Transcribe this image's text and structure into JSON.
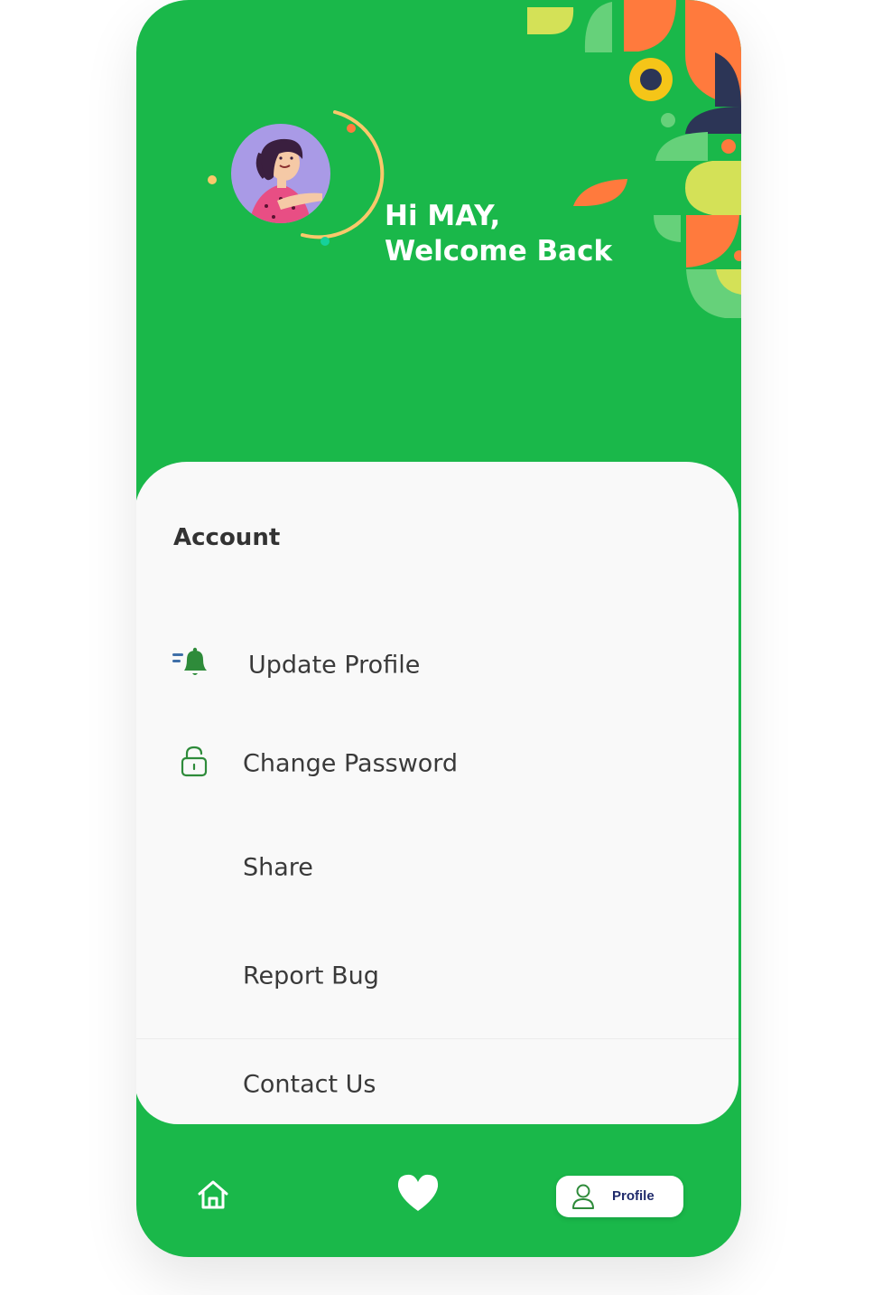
{
  "header": {
    "greeting_line1": "Hi MAY,",
    "greeting_line2": "Welcome Back"
  },
  "account": {
    "title": "Account",
    "items": [
      {
        "label": "Update Profile",
        "icon": "bell-icon"
      },
      {
        "label": "Change Password",
        "icon": "lock-icon"
      },
      {
        "label": "Share",
        "icon": ""
      },
      {
        "label": "Report Bug",
        "icon": ""
      },
      {
        "label": "Contact Us",
        "icon": ""
      }
    ]
  },
  "bottom_nav": {
    "items": [
      {
        "name": "home",
        "icon": "home-icon"
      },
      {
        "name": "favorites",
        "icon": "heart-icon"
      },
      {
        "name": "profile",
        "icon": "user-icon",
        "label": "Profile",
        "active": true
      }
    ]
  },
  "colors": {
    "primary_green": "#1ab84a",
    "card_bg": "#f9f9f9",
    "accent_orange": "#ff7a3d",
    "accent_navy": "#2c3556",
    "accent_yellow": "#f5c518",
    "avatar_bg": "#a99ae6",
    "nav_label": "#1f2a6b"
  }
}
